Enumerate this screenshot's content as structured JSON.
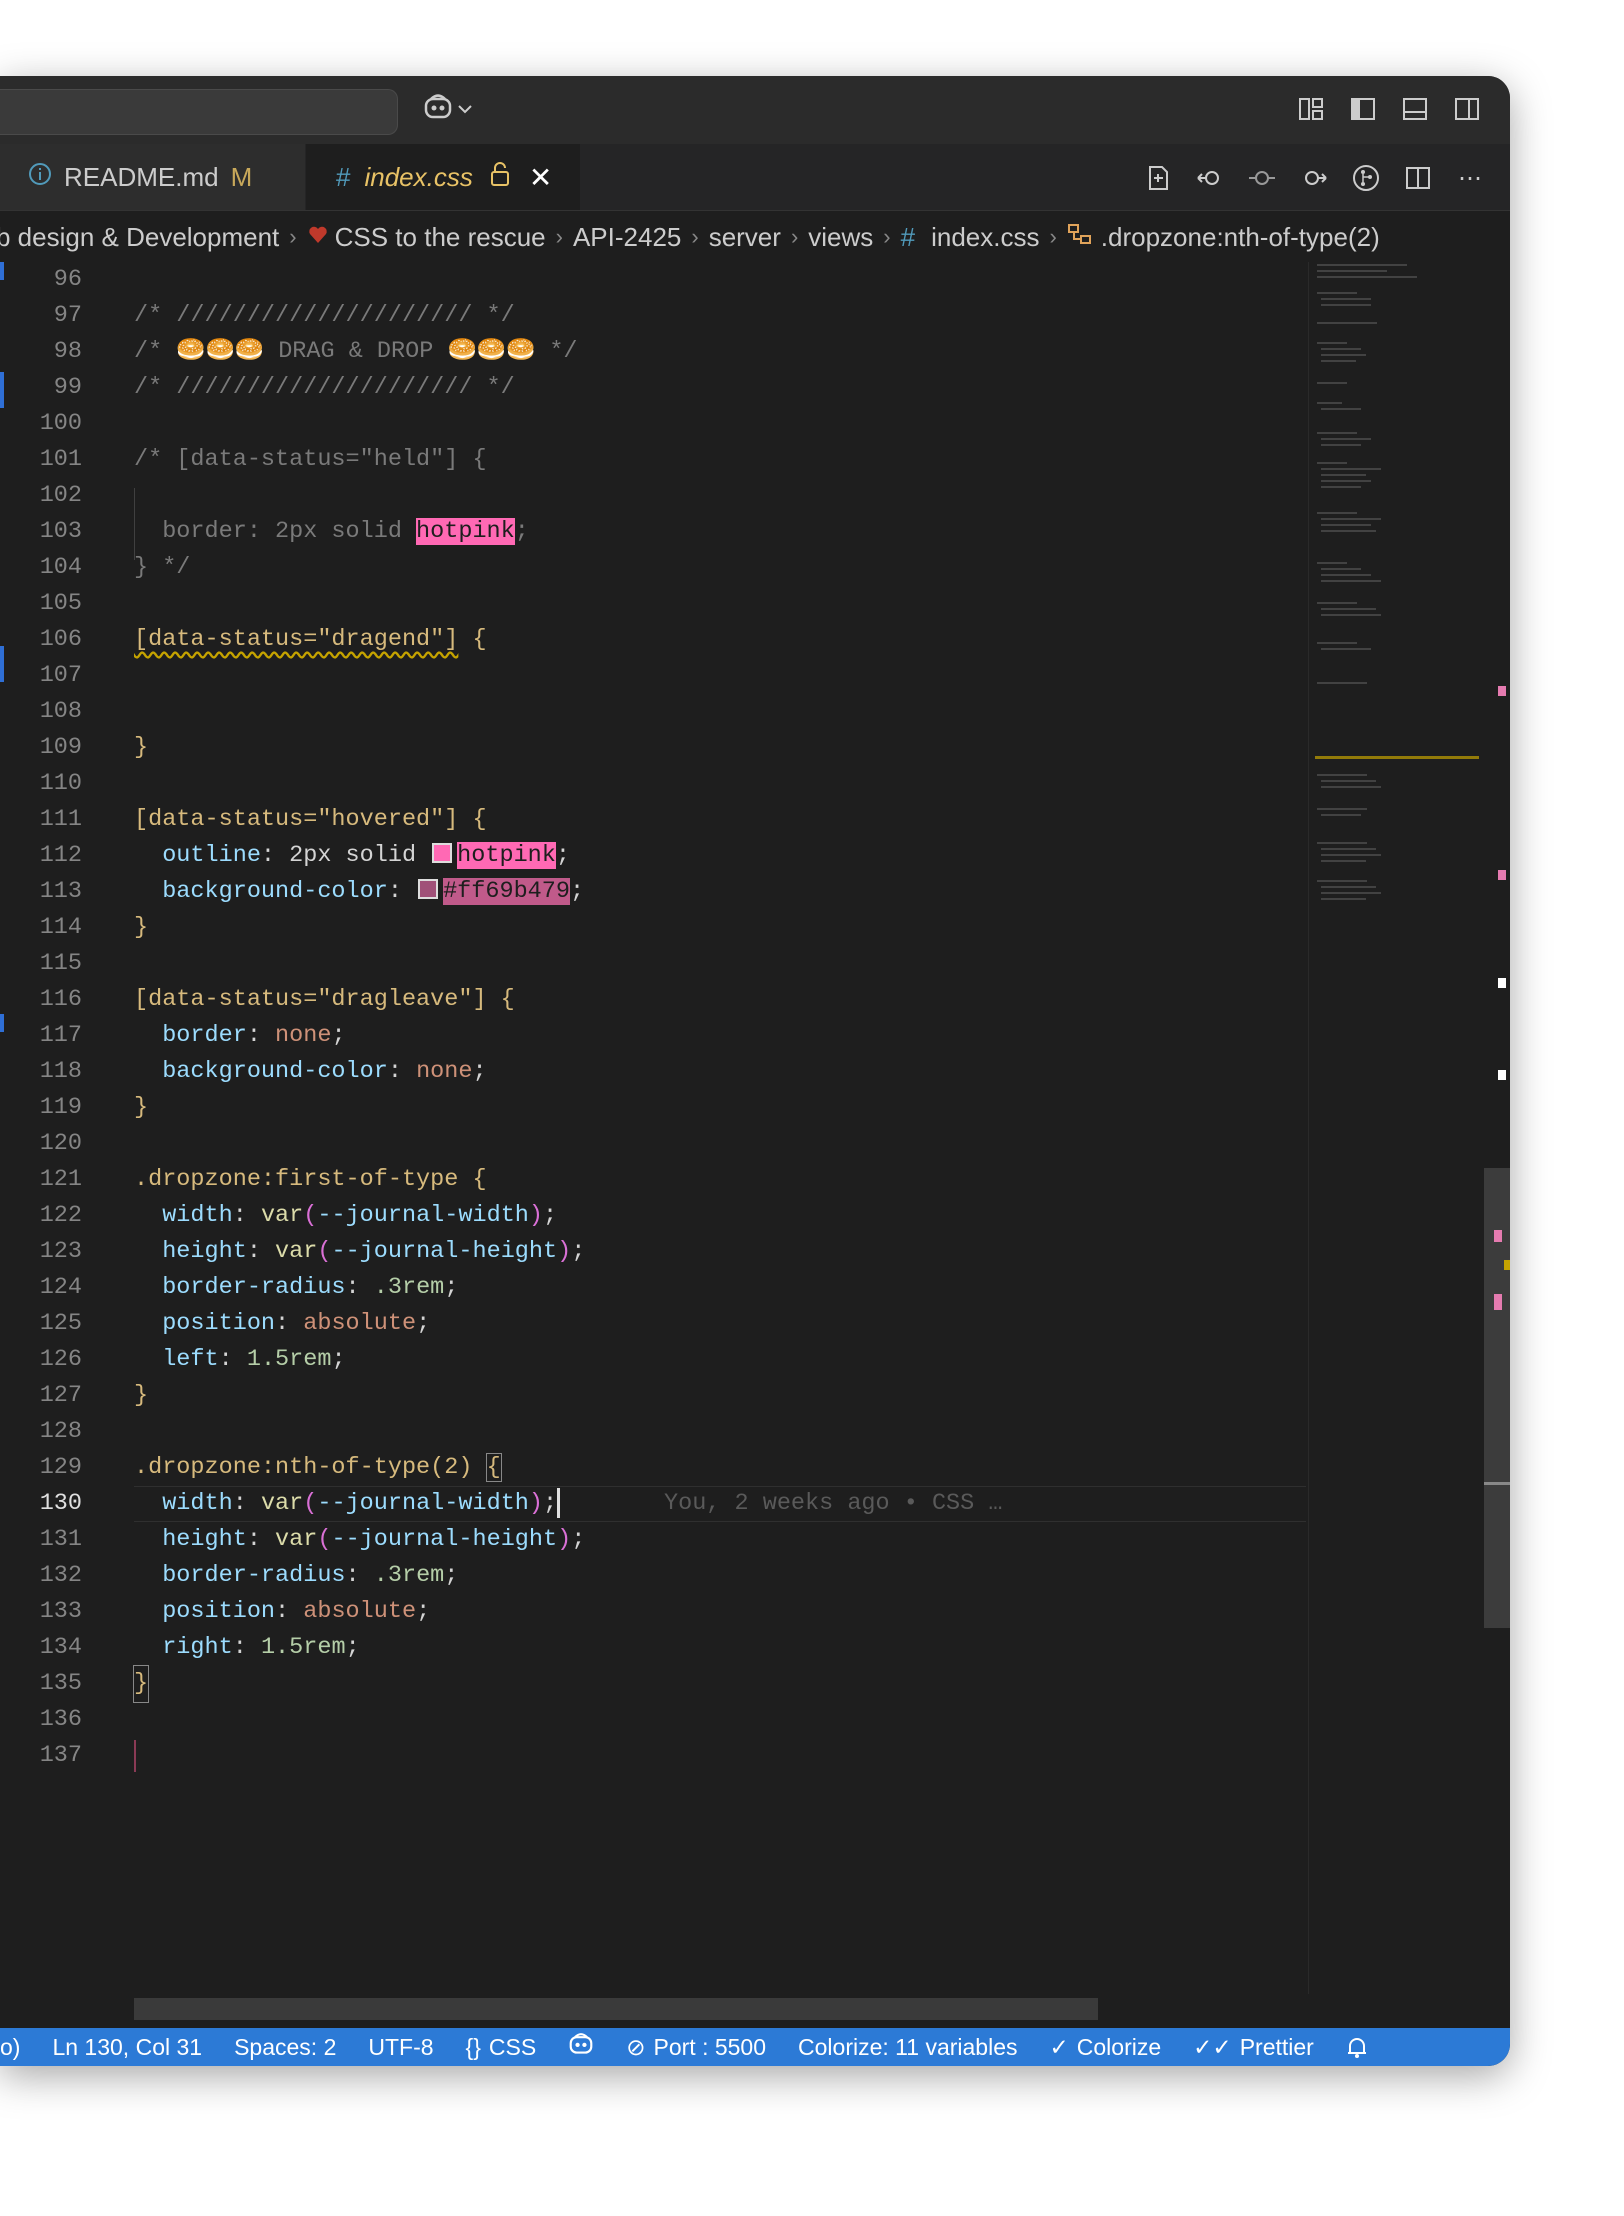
{
  "titlebar": {
    "copilot_label": "copilot"
  },
  "tabs": [
    {
      "label": "README.md",
      "badge": "M"
    },
    {
      "label": "index.css"
    }
  ],
  "breadcrumb": [
    "b design & Development",
    "CSS to the rescue",
    "API-2425",
    "server",
    "views",
    "index.css",
    ".dropzone:nth-of-type(2)"
  ],
  "editor": {
    "blame": "You, 2 weeks ago • CSS …",
    "line_numbers": [
      "96",
      "97",
      "98",
      "99",
      "100",
      "101",
      "102",
      "103",
      "104",
      "105",
      "106",
      "107",
      "108",
      "109",
      "110",
      "111",
      "112",
      "113",
      "114",
      "115",
      "116",
      "117",
      "118",
      "119",
      "120",
      "121",
      "122",
      "123",
      "124",
      "125",
      "126",
      "127",
      "128",
      "129",
      "130",
      "131",
      "132",
      "133",
      "134",
      "135",
      "136",
      "137"
    ],
    "code": {
      "l97": "/* ///////////////////// */",
      "l98_pre": "/* ",
      "l98_emoji_1": "🥯🥯🥯",
      "l98_mid": " DRAG & DROP ",
      "l98_emoji_2": "🥯🥯🥯",
      "l98_post": " */",
      "l99": "/* ///////////////////// */",
      "l101": "/* [data-status=\"held\"] {",
      "l103_pre": "  border: 2px solid ",
      "l103_hot": "hotpink",
      "l103_post": ";",
      "l104": "} */",
      "l106_sel": "[data-status=\"dragend\"]",
      "l106_brace": " {",
      "l109": "}",
      "l111_sel": "[data-status=\"hovered\"]",
      "l111_brace": " {",
      "l112_prop": "  outline",
      "l112_mid": ": 2px solid ",
      "l112_val": "hotpink",
      "l112_end": ";",
      "l113_prop": "  background-color",
      "l113_mid": ": ",
      "l113_val": "#ff69b479",
      "l113_end": ";",
      "l114": "}",
      "l116_sel": "[data-status=\"dragleave\"]",
      "l116_brace": " {",
      "l117_prop": "  border",
      "l117_mid": ": ",
      "l117_val": "none",
      "l117_end": ";",
      "l118_prop": "  background-color",
      "l118_mid": ": ",
      "l118_val": "none",
      "l118_end": ";",
      "l119": "}",
      "l121_sel": ".dropzone:first-of-type",
      "l121_brace": " {",
      "l122_prop": "  width",
      "l122_fn": "var",
      "l122_var": "--journal-width",
      "l123_prop": "  height",
      "l123_fn": "var",
      "l123_var": "--journal-height",
      "l124_prop": "  border-radius",
      "l124_val": ".3rem",
      "l125_prop": "  position",
      "l125_val": "absolute",
      "l126_prop": "  left",
      "l126_val": "1.5rem",
      "l127": "}",
      "l129_sel": ".dropzone:nth-of-type(2)",
      "l129_brace": "{",
      "l130_prop": "  width",
      "l130_fn": "var",
      "l130_var": "--journal-width",
      "l131_prop": "  height",
      "l131_fn": "var",
      "l131_var": "--journal-height",
      "l132_prop": "  border-radius",
      "l132_val": ".3rem",
      "l133_prop": "  position",
      "l133_val": "absolute",
      "l134_prop": "  right",
      "l134_val": "1.5rem",
      "l135": "}"
    }
  },
  "statusbar": {
    "left_fragment": "o)",
    "position": "Ln 130, Col 31",
    "spaces": "Spaces: 2",
    "encoding": "UTF-8",
    "language": "CSS",
    "port": "Port : 5500",
    "colorize": "Colorize: 11 variables",
    "colorize_toggle": "Colorize",
    "prettier": "Prettier"
  },
  "colors": {
    "hotpink": "#ff69b4",
    "statusbar": "#2c7ad6",
    "selector": "#d7ba7d",
    "property": "#9cdcfe"
  }
}
